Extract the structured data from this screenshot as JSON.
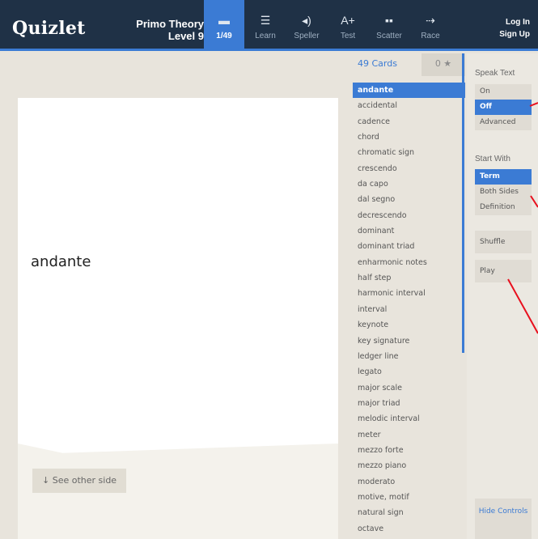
{
  "header": {
    "logo": "Quizlet",
    "set_title_line1": "Primo Theory",
    "set_title_line2": "Level 9",
    "nav": [
      {
        "icon": "cards-icon",
        "glyph": "▬",
        "label": "1/49"
      },
      {
        "icon": "learn-icon",
        "glyph": "☰",
        "label": "Learn"
      },
      {
        "icon": "speller-icon",
        "glyph": "◂)",
        "label": "Speller"
      },
      {
        "icon": "test-icon",
        "glyph": "A+",
        "label": "Test"
      },
      {
        "icon": "scatter-icon",
        "glyph": "▪▪",
        "label": "Scatter"
      },
      {
        "icon": "race-icon",
        "glyph": "⇢",
        "label": "Race"
      }
    ],
    "login": "Log In",
    "signup": "Sign Up"
  },
  "card": {
    "term": "andante",
    "flip_label": "↓ See other side"
  },
  "list": {
    "count": "49 Cards",
    "starred": "0 ★",
    "items": [
      "andante",
      "accidental",
      "cadence",
      "chord",
      "chromatic sign",
      "crescendo",
      "da capo",
      "dal segno",
      "decrescendo",
      "dominant",
      "dominant triad",
      "enharmonic notes",
      "half step",
      "harmonic interval",
      "interval",
      "keynote",
      "key signature",
      "ledger line",
      "legato",
      "major scale",
      "major triad",
      "melodic interval",
      "meter",
      "mezzo forte",
      "mezzo piano",
      "moderato",
      "motive, motif",
      "natural sign",
      "octave"
    ]
  },
  "controls": {
    "speak_label": "Speak Text",
    "speak_options": [
      "On",
      "Off",
      "Advanced"
    ],
    "speak_selected": 1,
    "start_label": "Start With",
    "start_options": [
      "Term",
      "Both Sides",
      "Definition"
    ],
    "start_selected": 0,
    "shuffle": "Shuffle",
    "play": "Play",
    "hide": "Hide Controls"
  },
  "colors": {
    "header_bg": "#1f3146",
    "accent": "#3b7bd4",
    "annotation": "#e8101e"
  }
}
